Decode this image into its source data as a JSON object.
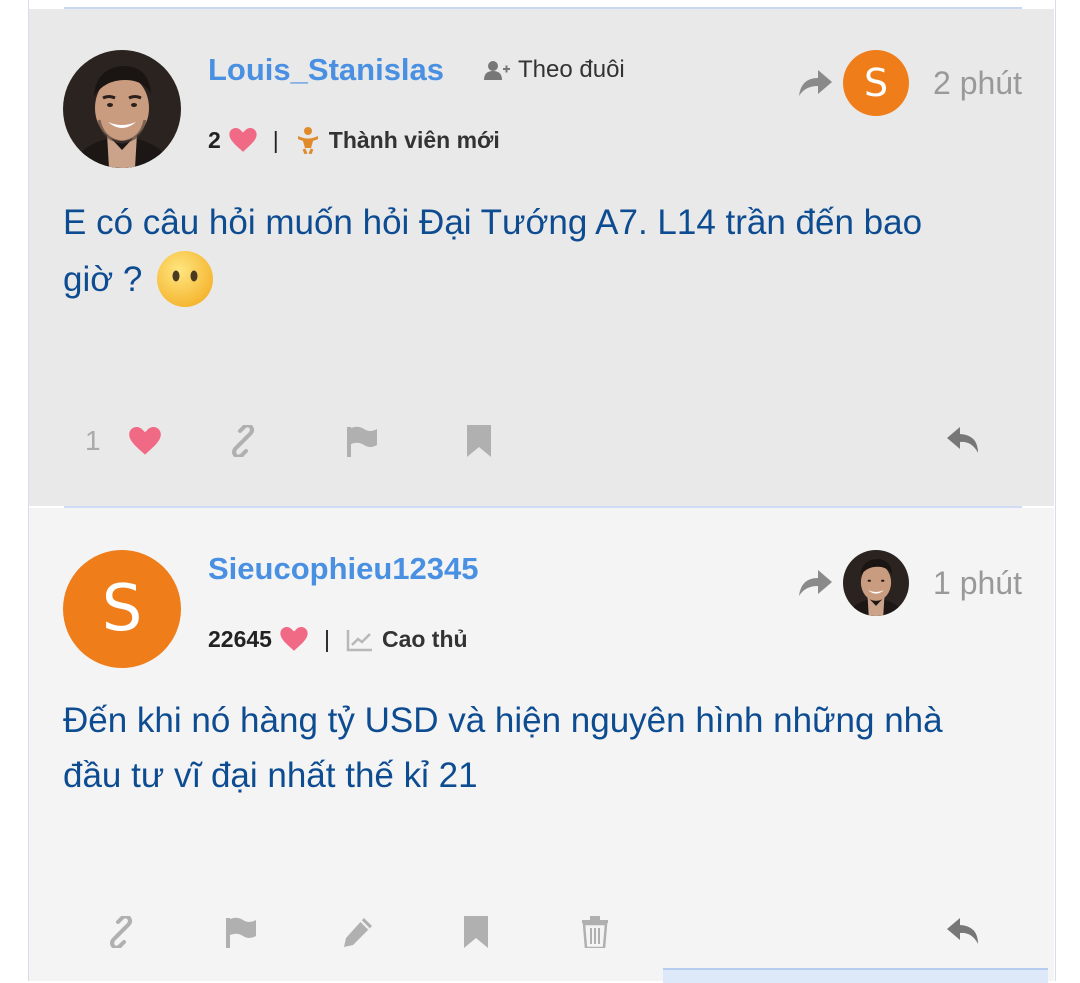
{
  "posts": [
    {
      "username": "Louis_Stanislas",
      "follow_label": "Theo đuôi",
      "likes": "2",
      "rank": "Thành viên mới",
      "reply_to_avatar_letter": "S",
      "time": "2 phút",
      "content_line1": "E có câu hỏi muốn hỏi Đại Tướng A7. L14 trần đến bao",
      "content_line2": "giờ ?",
      "emoji": "😶",
      "like_count": "1",
      "actions": [
        "heart-icon",
        "link-icon",
        "flag-icon",
        "bookmark-icon",
        "reply-icon"
      ]
    },
    {
      "username": "Sieucophieu12345",
      "avatar_letter": "S",
      "likes": "22645",
      "rank": "Cao thủ",
      "time": "1 phút",
      "content_line1": "Đến khi nó hàng tỷ USD và hiện nguyên hình những nhà",
      "content_line2": "đầu tư vĩ đại nhất thế kỉ 21",
      "actions": [
        "link-icon",
        "flag-icon",
        "pencil-icon",
        "bookmark-icon",
        "trash-icon",
        "reply-icon"
      ]
    }
  ],
  "colors": {
    "username": "#4a90e2",
    "content": "#0e4c92",
    "heart": "#f06a86",
    "avatar_orange": "#ef7d1a",
    "icon_gray": "#a7a7a7"
  }
}
